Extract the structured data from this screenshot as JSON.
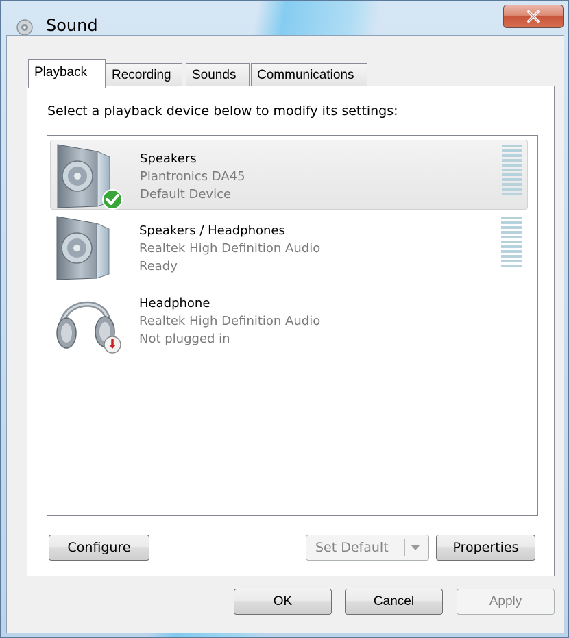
{
  "window": {
    "title": "Sound"
  },
  "tabs": [
    {
      "label": "Playback",
      "active": true
    },
    {
      "label": "Recording",
      "active": false
    },
    {
      "label": "Sounds",
      "active": false
    },
    {
      "label": "Communications",
      "active": false
    }
  ],
  "playback": {
    "instructions": "Select a playback device below to modify its settings:",
    "devices": [
      {
        "name": "Speakers",
        "driver": "Plantronics DA45",
        "status": "Default Device",
        "icon": "speaker-icon",
        "badge": "green-check-icon",
        "selected": true,
        "meter_level": 0
      },
      {
        "name": "Speakers / Headphones",
        "driver": "Realtek High Definition Audio",
        "status": "Ready",
        "icon": "speaker-icon",
        "badge": "",
        "selected": false,
        "meter_level": 0
      },
      {
        "name": "Headphone",
        "driver": "Realtek High Definition Audio",
        "status": "Not plugged in",
        "icon": "headphone-icon",
        "badge": "red-down-arrow-icon",
        "selected": false
      }
    ],
    "buttons": {
      "configure": "Configure",
      "set_default": "Set Default",
      "properties": "Properties"
    }
  },
  "dialog_buttons": {
    "ok": "OK",
    "cancel": "Cancel",
    "apply": "Apply"
  },
  "colors": {
    "accent_glass": "#bcd4ea",
    "meter": "#b6d2dc",
    "check_green": "#3aa63a",
    "badge_red": "#cc2222",
    "close_red": "#c8553a"
  }
}
